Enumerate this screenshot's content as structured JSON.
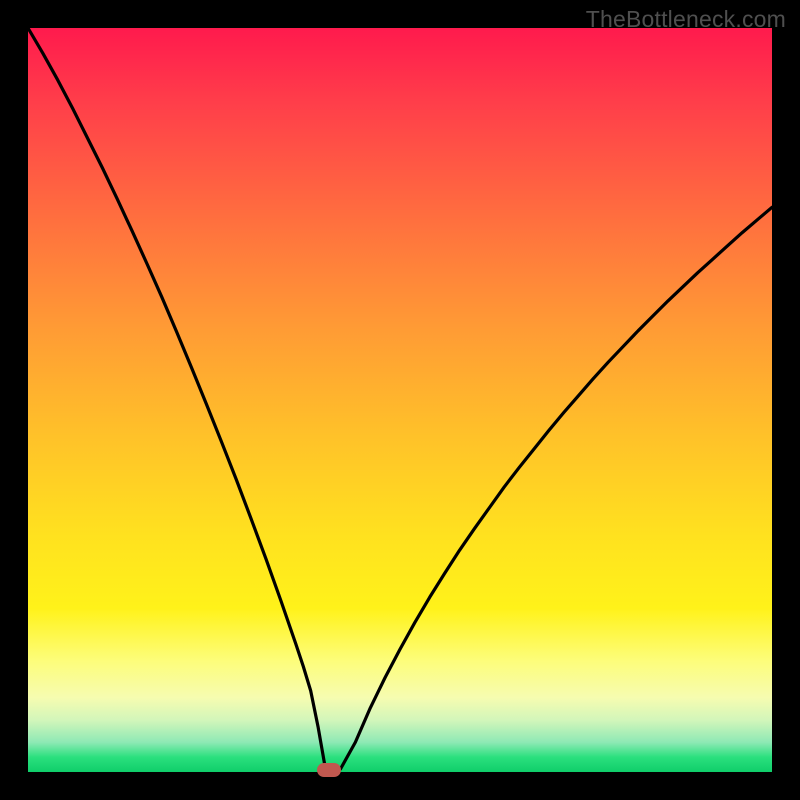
{
  "watermark": "TheBottleneck.com",
  "colors": {
    "frame": "#000000",
    "curve": "#000000",
    "marker": "#c0584f"
  },
  "chart_data": {
    "type": "line",
    "title": "",
    "xlabel": "",
    "ylabel": "",
    "xlim": [
      0,
      100
    ],
    "ylim": [
      0,
      100
    ],
    "grid": false,
    "curve_description": "V-shaped bottleneck curve: sharp decline to ~0 at x≈40 then rises, right arm shallower than left.",
    "x": [
      0,
      2,
      4,
      6,
      8,
      10,
      12,
      14,
      16,
      18,
      20,
      22,
      24,
      26,
      28,
      30,
      32,
      34,
      36,
      37,
      38,
      39,
      40,
      41,
      42,
      44,
      46,
      48,
      50,
      52,
      54,
      56,
      58,
      60,
      62,
      64,
      66,
      68,
      70,
      72,
      74,
      76,
      78,
      80,
      82,
      84,
      86,
      88,
      90,
      92,
      94,
      96,
      98,
      100
    ],
    "y": [
      100,
      96.6,
      93.0,
      89.2,
      85.2,
      81.2,
      77.0,
      72.7,
      68.3,
      63.8,
      59.1,
      54.3,
      49.4,
      44.4,
      39.3,
      34.0,
      28.6,
      23.0,
      17.2,
      14.2,
      10.9,
      6.0,
      0.3,
      0.3,
      0.4,
      4.0,
      8.6,
      12.7,
      16.5,
      20.1,
      23.5,
      26.7,
      29.8,
      32.7,
      35.5,
      38.3,
      40.9,
      43.4,
      45.9,
      48.3,
      50.6,
      52.9,
      55.1,
      57.2,
      59.3,
      61.3,
      63.3,
      65.2,
      67.1,
      68.9,
      70.7,
      72.5,
      74.2,
      75.9
    ],
    "marker": {
      "x": 40.5,
      "y": 0.3
    },
    "gradient_stops": [
      {
        "pos": 0,
        "color": "#ff1a4d"
      },
      {
        "pos": 25,
        "color": "#ff6d3f"
      },
      {
        "pos": 55,
        "color": "#ffc229"
      },
      {
        "pos": 78,
        "color": "#fff21a"
      },
      {
        "pos": 93,
        "color": "#d3f6ba"
      },
      {
        "pos": 100,
        "color": "#0fce6a"
      }
    ]
  }
}
